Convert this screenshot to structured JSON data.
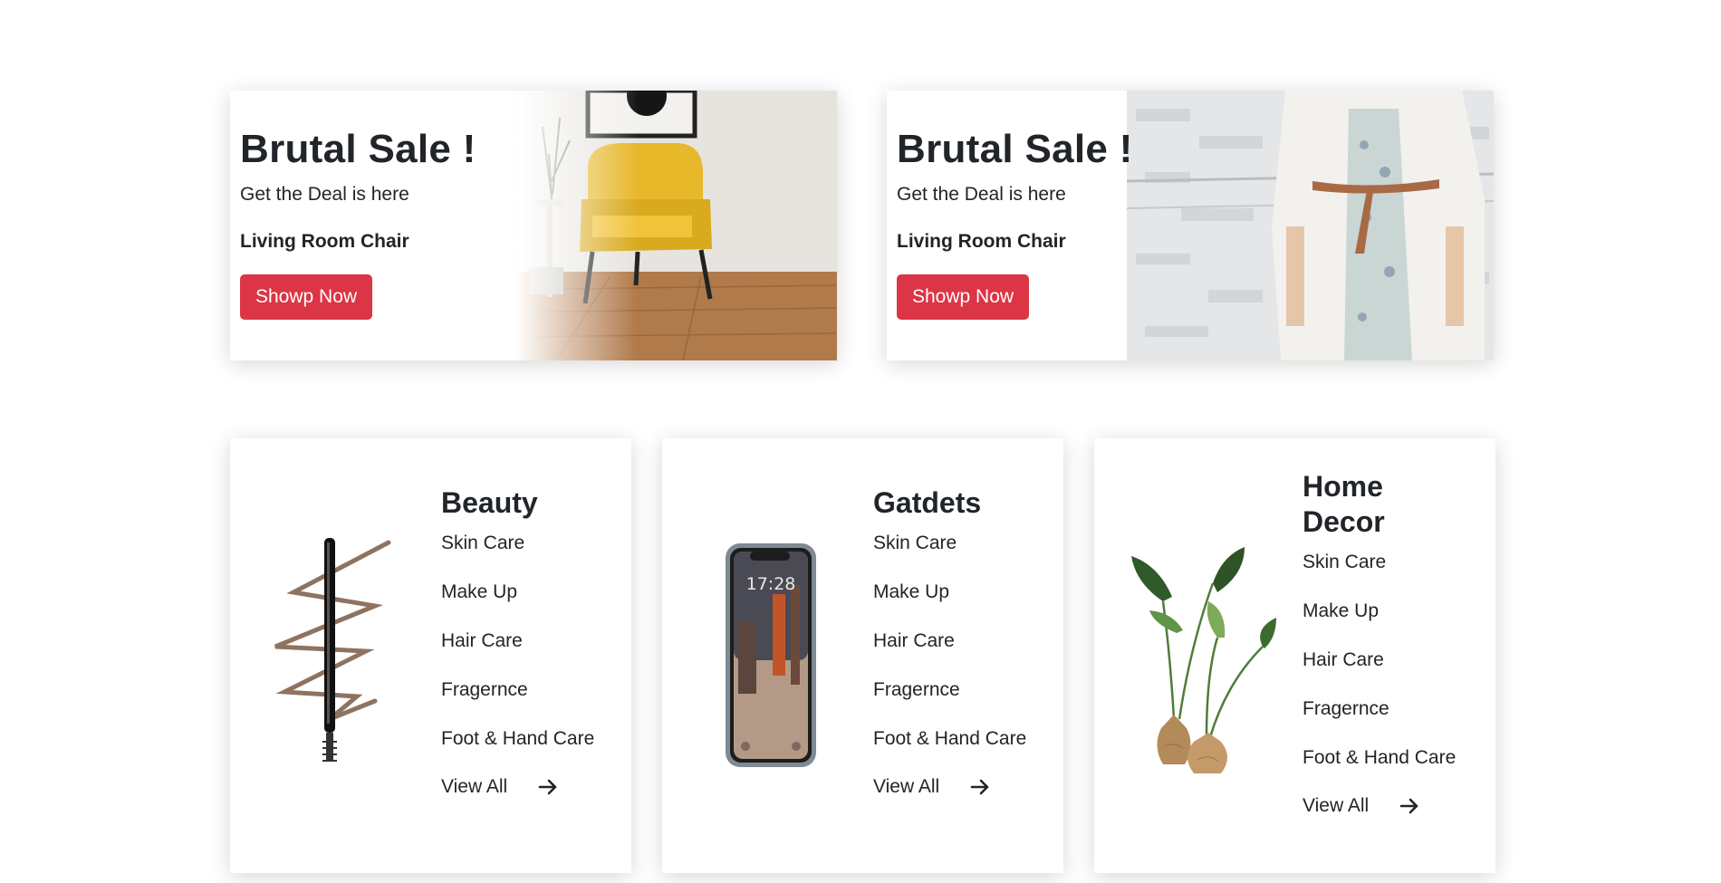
{
  "colors": {
    "accent": "#dc3545",
    "text": "#212529"
  },
  "promos": [
    {
      "title": "Brutal Sale !",
      "subtitle": "Get the Deal is here",
      "product": "Living Room Chair",
      "button": "Showp Now",
      "image": "yellow-armchair-photo"
    },
    {
      "title": "Brutal Sale !",
      "subtitle": "Get the Deal is here",
      "product": "Living Room Chair",
      "button": "Showp Now",
      "image": "woman-white-coat-photo"
    }
  ],
  "categories": [
    {
      "title": "Beauty",
      "items": [
        "Skin Care",
        "Make Up",
        "Hair Care",
        "Fragernce",
        "Foot & Hand Care"
      ],
      "view_all": "View All",
      "image": "brow-pencil-photo"
    },
    {
      "title": "Gatdets",
      "items": [
        "Skin Care",
        "Make Up",
        "Hair Care",
        "Fragernce",
        "Foot & Hand Care"
      ],
      "view_all": "View All",
      "image": "smartphone-photo"
    },
    {
      "title": "Home Decor",
      "items": [
        "Skin Care",
        "Make Up",
        "Hair Care",
        "Fragernce",
        "Foot & Hand Care"
      ],
      "view_all": "View All",
      "image": "potted-plant-photo"
    }
  ],
  "phone": {
    "time": "17:28"
  }
}
